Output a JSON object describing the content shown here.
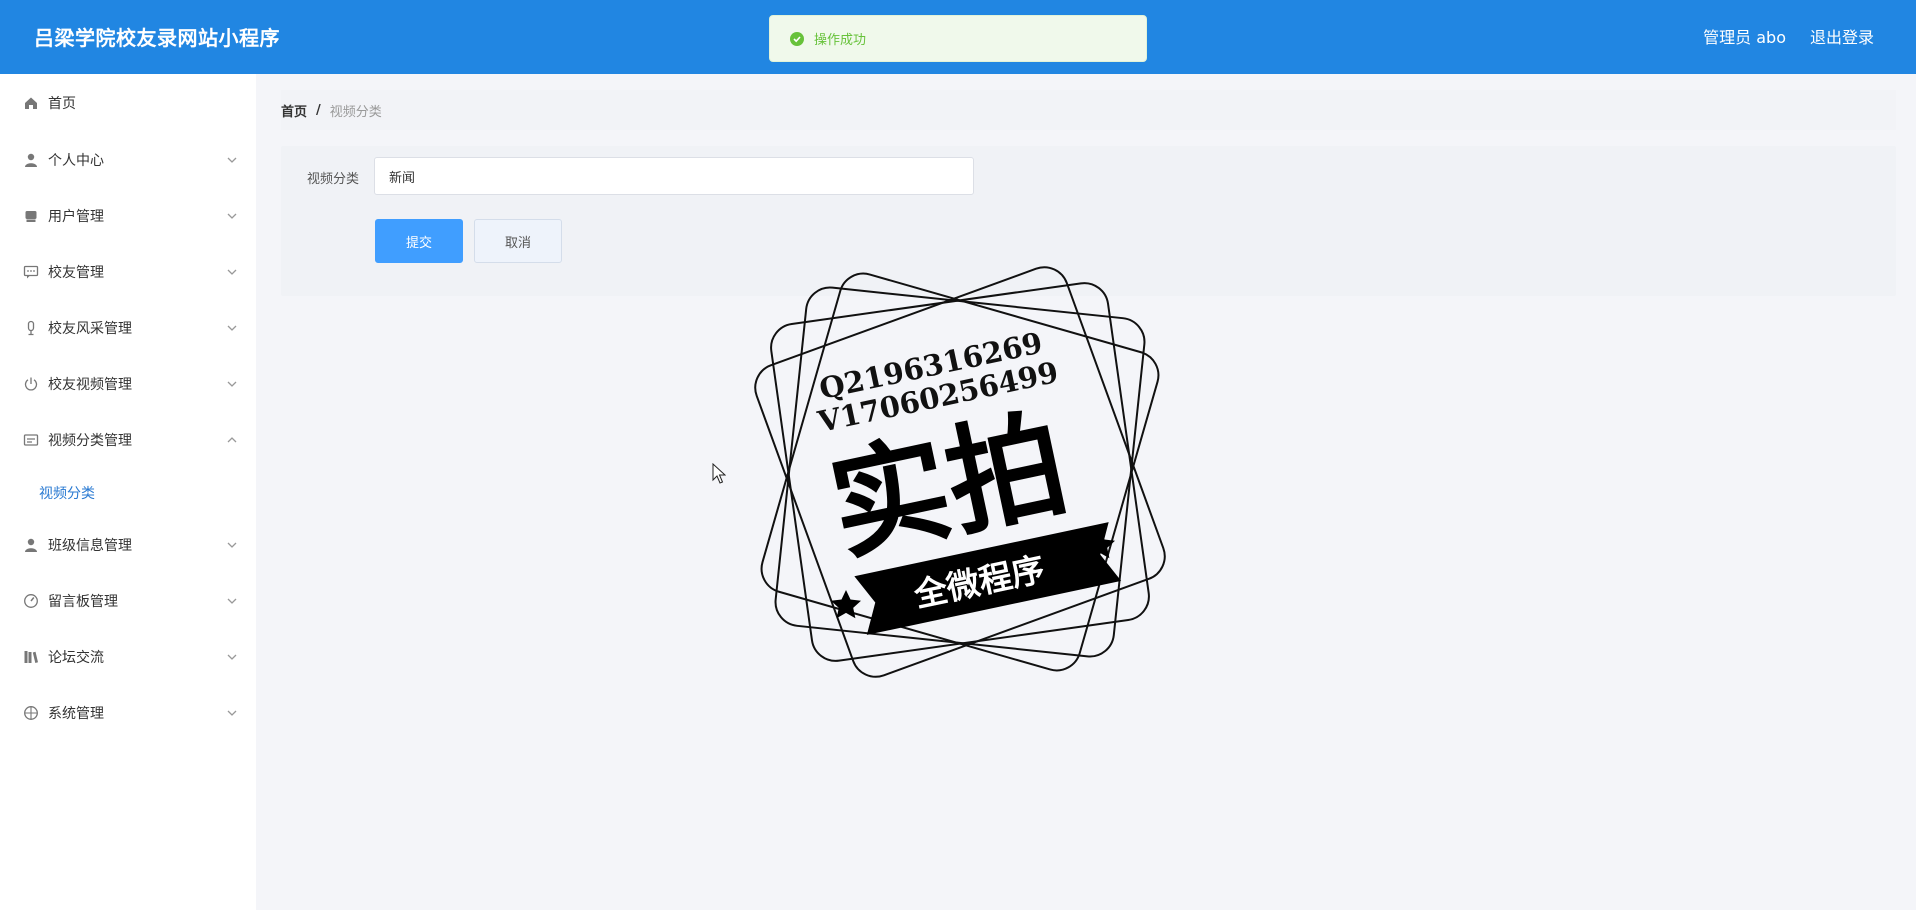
{
  "header": {
    "title": "吕梁学院校友录网站小程序",
    "user_label": "管理员 abo",
    "logout_label": "退出登录"
  },
  "toast": {
    "message": "操作成功",
    "type": "success",
    "color": "#67c23a"
  },
  "sidebar": {
    "items": [
      {
        "label": "首页",
        "icon": "home-icon"
      },
      {
        "label": "个人中心",
        "icon": "person-icon"
      },
      {
        "label": "用户管理",
        "icon": "user-manage-icon"
      },
      {
        "label": "校友管理",
        "icon": "chat-icon"
      },
      {
        "label": "校友风采管理",
        "icon": "mic-icon"
      },
      {
        "label": "校友视频管理",
        "icon": "power-icon"
      },
      {
        "label": "视频分类管理",
        "icon": "card-icon",
        "expanded": true
      },
      {
        "label": "班级信息管理",
        "icon": "user-icon"
      },
      {
        "label": "留言板管理",
        "icon": "gauge-icon"
      },
      {
        "label": "论坛交流",
        "icon": "books-icon"
      },
      {
        "label": "系统管理",
        "icon": "compass-icon"
      }
    ],
    "sub_items": [
      {
        "label": "视频分类",
        "active": true
      }
    ]
  },
  "breadcrumb": {
    "home": "首页",
    "separator": "/",
    "current": "视频分类"
  },
  "form": {
    "category_label": "视频分类",
    "category_value": "新闻",
    "submit_label": "提交",
    "cancel_label": "取消"
  },
  "watermark": {
    "line1": "Q2196316269",
    "line2": "V17060256499",
    "big_text": "实拍",
    "banner_text": "全微程序"
  },
  "colors": {
    "header_bg": "#2186e2",
    "primary": "#409eff",
    "active_menu": "#2a7ad2",
    "page_bg": "#f4f5f9"
  }
}
